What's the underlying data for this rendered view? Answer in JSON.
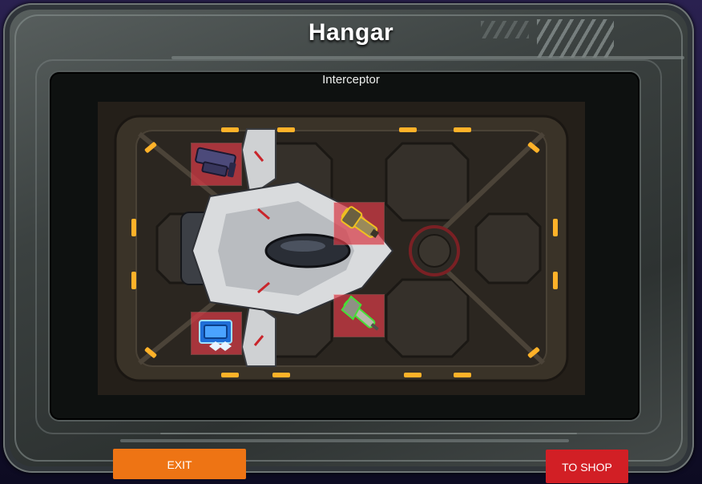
{
  "screen": {
    "title": "Hangar",
    "ship_name": "Interceptor"
  },
  "equipment_slots": [
    {
      "item": "missile-launcher-icon",
      "highlight": "#d73c46"
    },
    {
      "item": "cannon-icon",
      "highlight": "#d73c46"
    },
    {
      "item": "laser-gun-icon",
      "highlight": "#d73c46"
    },
    {
      "item": "shield-generator-icon",
      "highlight": "#d73c46"
    }
  ],
  "buttons": {
    "exit_label": "EXIT",
    "shop_label": "TO SHOP"
  },
  "colors": {
    "exit_button": "#ee7414",
    "shop_button": "#d21f25",
    "slot_highlight": "#d73c46",
    "runway_lights": "#ffb229"
  }
}
